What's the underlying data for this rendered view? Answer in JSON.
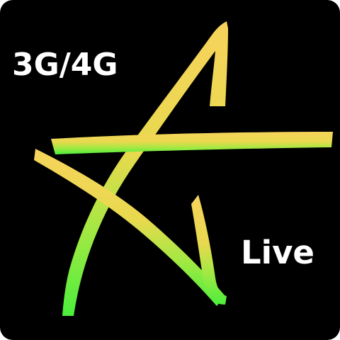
{
  "icon": {
    "network_label": "3G/4G",
    "live_label": "Live",
    "logo": "star-logo",
    "colors": {
      "background": "#000000",
      "text": "#ffffff",
      "gradient_top": "#f7d35c",
      "gradient_mid": "#d8e04c",
      "gradient_bottom": "#4cee3c"
    }
  }
}
